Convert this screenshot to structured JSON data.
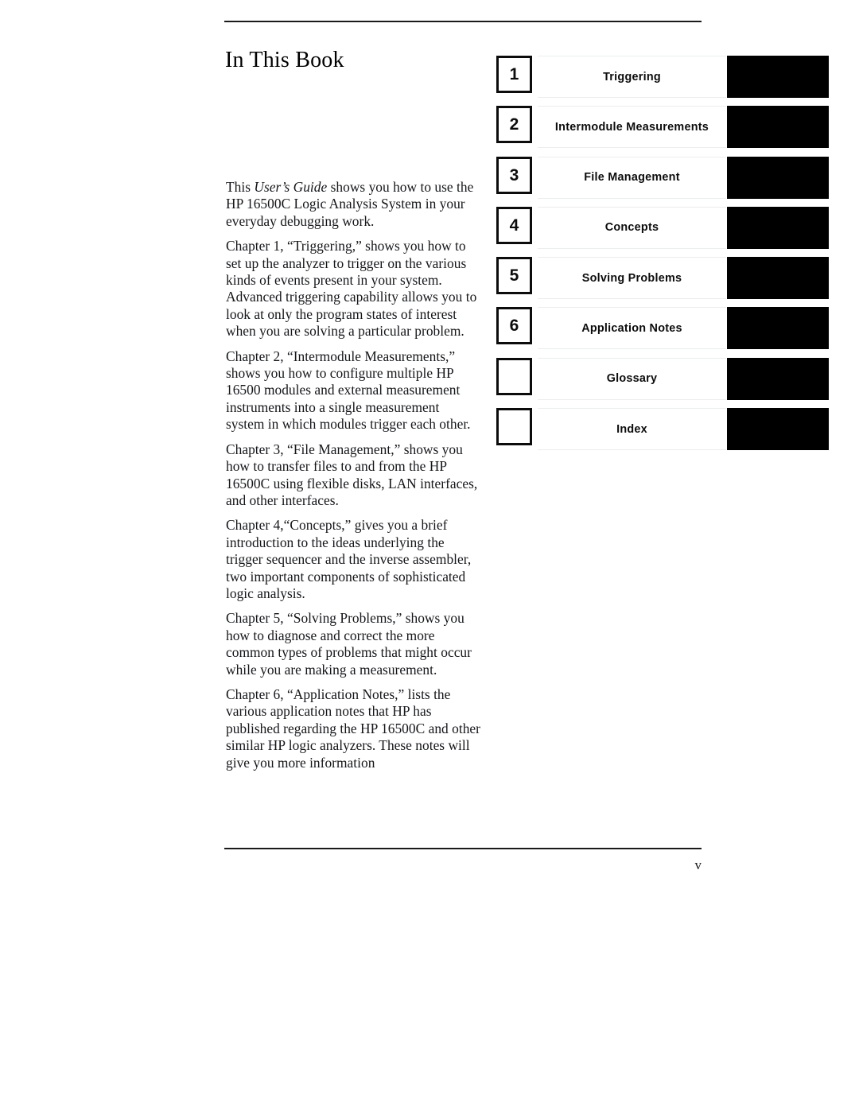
{
  "document": {
    "title": "In This Book",
    "page_number": "v"
  },
  "body": {
    "paragraphs": [
      {
        "id": "intro",
        "prefix": "This ",
        "italic": "User’s Guide",
        "suffix": " shows you how to use the HP 16500C Logic Analysis System in your everyday debugging work."
      },
      {
        "id": "chapter-1",
        "text": "Chapter 1, “Triggering,” shows you how to set up the analyzer to trigger on the various kinds of events present in your system. Advanced triggering capability allows you to look at only the program states of interest when you are solving a particular problem."
      },
      {
        "id": "chapter-2",
        "text": "Chapter 2, “Intermodule Measurements,” shows you how to configure multiple HP 16500 modules and external measurement instruments into a single measurement system in which modules trigger each other."
      },
      {
        "id": "chapter-3",
        "text": "Chapter 3, “File Management,” shows you how to transfer files to and from the HP 16500C using flexible disks, LAN interfaces, and other interfaces."
      },
      {
        "id": "chapter-4",
        "text": "Chapter 4,“Concepts,” gives you a brief introduction to the ideas underlying the trigger sequencer and the inverse assembler, two important components of sophisticated logic analysis."
      },
      {
        "id": "chapter-5",
        "text": "Chapter 5, “Solving Problems,” shows you how to diagnose and correct the more common types of problems that might occur while you are making a measurement."
      },
      {
        "id": "chapter-6",
        "text": "Chapter 6, “Application Notes,” lists the various application notes that HP has published regarding the HP 16500C and other similar HP logic analyzers. These notes will give you more information"
      }
    ]
  },
  "chapter_index": {
    "rows": [
      {
        "number": "1",
        "label": "Triggering"
      },
      {
        "number": "2",
        "label": "Intermodule Measurements"
      },
      {
        "number": "3",
        "label": "File Management"
      },
      {
        "number": "4",
        "label": "Concepts"
      },
      {
        "number": "5",
        "label": "Solving Problems"
      },
      {
        "number": "6",
        "label": "Application Notes"
      },
      {
        "number": "",
        "label": "Glossary"
      },
      {
        "number": "",
        "label": "Index"
      }
    ]
  },
  "colors": {
    "text": "#15161a",
    "tab_block": "#000000",
    "box_border": "#0c0c0c",
    "hairline": "#eceded"
  }
}
